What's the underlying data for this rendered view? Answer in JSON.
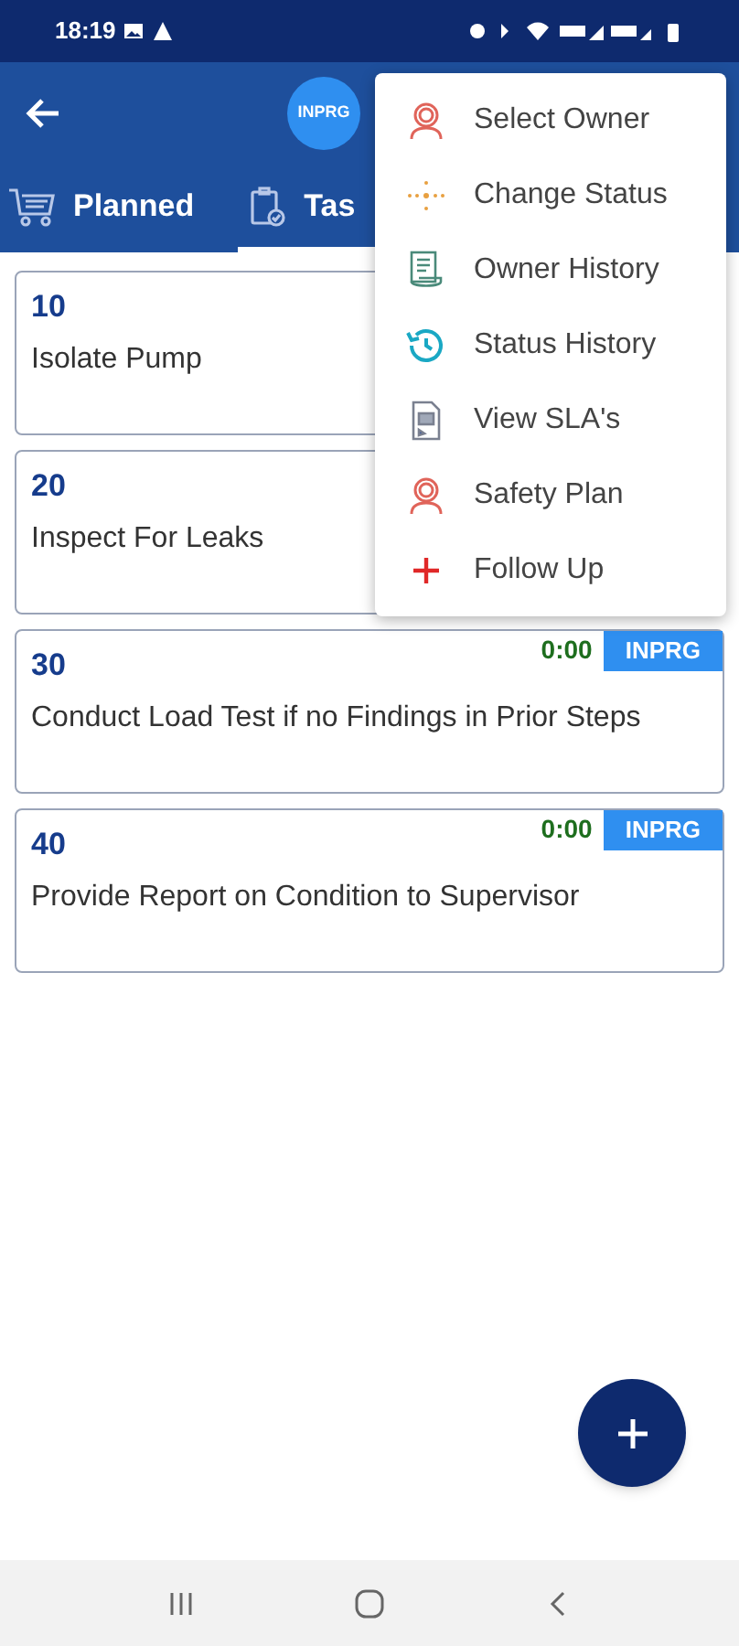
{
  "status_bar": {
    "time": "18:19"
  },
  "header": {
    "status_badge": "INPRG"
  },
  "tabs": [
    {
      "label": "Planned",
      "selected": false
    },
    {
      "label": "Tas",
      "selected": true
    }
  ],
  "tasks": [
    {
      "number": "10",
      "title": "Isolate Pump"
    },
    {
      "number": "20",
      "title": "Inspect For Leaks"
    },
    {
      "number": "30",
      "title": "Conduct Load Test if no Findings in Prior Steps",
      "time": "0:00",
      "status": "INPRG"
    },
    {
      "number": "40",
      "title": "Provide Report on Condition to Supervisor",
      "time": "0:00",
      "status": "INPRG"
    }
  ],
  "menu": [
    {
      "label": "Select Owner",
      "kind": "owner"
    },
    {
      "label": "Change Status",
      "kind": "status"
    },
    {
      "label": "Owner History",
      "kind": "ownerhistory"
    },
    {
      "label": "Status History",
      "kind": "history"
    },
    {
      "label": "View SLA's",
      "kind": "sla"
    },
    {
      "label": "Safety Plan",
      "kind": "owner"
    },
    {
      "label": "Follow Up",
      "kind": "plus"
    }
  ]
}
